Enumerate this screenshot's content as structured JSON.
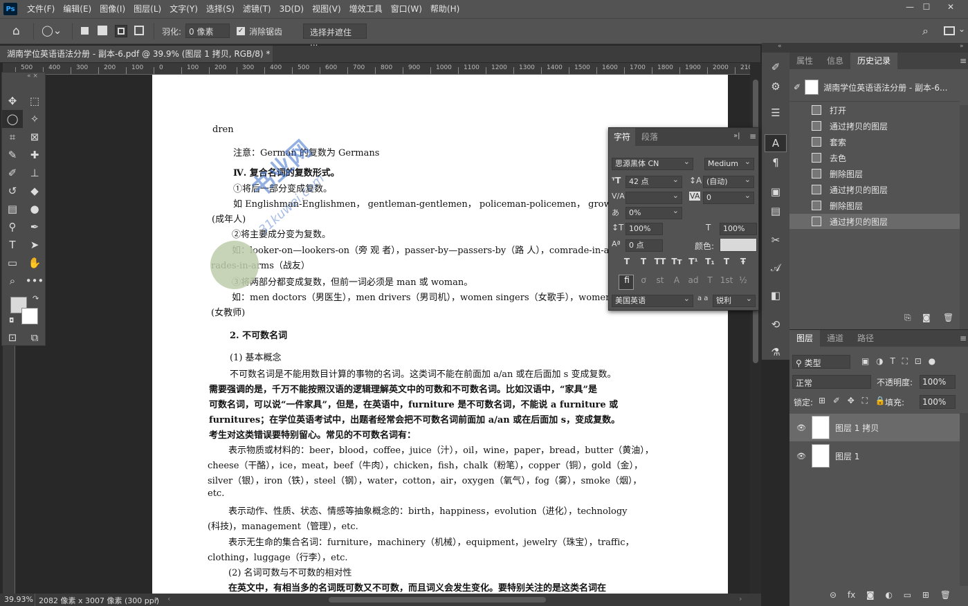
{
  "menu": [
    "文件(F)",
    "编辑(E)",
    "图像(I)",
    "图层(L)",
    "文字(Y)",
    "选择(S)",
    "滤镜(T)",
    "3D(D)",
    "视图(V)",
    "增效工具",
    "窗口(W)",
    "帮助(H)"
  ],
  "app_logo": "Ps",
  "options": {
    "feather_label": "羽化:",
    "feather_value": "0 像素",
    "antialias_label": "消除锯齿",
    "select_mask_label": "选择并遮住 ..."
  },
  "doc_tab": {
    "title": "湖南学位英语语法分册 - 副本-6.pdf @ 39.9% (图层 1 拷贝, RGB/8) *",
    "close": "×"
  },
  "ruler_h": [
    "500",
    "400",
    "300",
    "200",
    "100",
    "0",
    "100",
    "200",
    "300",
    "400",
    "500",
    "600",
    "700",
    "800",
    "900",
    "1000",
    "1100",
    "1200",
    "1300",
    "1400",
    "1500",
    "1600",
    "1700",
    "1800",
    "1900",
    "2000",
    "2100"
  ],
  "status": {
    "zoom": "39.93%",
    "info": "2082 像素 x 3007 像素 (300 ppi)"
  },
  "history_panel": {
    "tabs": [
      "属性",
      "信息",
      "历史记录"
    ],
    "snapshot": "湖南学位英语语法分册 - 副本-6...",
    "items": [
      "打开",
      "通过拷贝的图层",
      "套索",
      "去色",
      "删除图层",
      "通过拷贝的图层",
      "删除图层",
      "通过拷贝的图层"
    ]
  },
  "layers_panel": {
    "tabs": [
      "图层",
      "通道",
      "路径"
    ],
    "filter_label": "类型",
    "blend_mode": "正常",
    "opacity_label": "不透明度:",
    "opacity": "100%",
    "lock_label": "锁定:",
    "fill_label": "填充:",
    "fill": "100%",
    "layers": [
      {
        "name": "图层 1 拷贝",
        "selected": true
      },
      {
        "name": "图层 1",
        "selected": false
      }
    ]
  },
  "char_panel": {
    "tabs": [
      "字符",
      "段落"
    ],
    "font_family": "思源黑体 CN",
    "font_style": "Medium",
    "size": "42 点",
    "leading": "(自动)",
    "kerning": "",
    "tracking": "0",
    "scale_tsume": "0%",
    "vscale": "100%",
    "hscale": "100%",
    "baseline": "0 点",
    "color_label": "颜色:",
    "language": "美国英语",
    "antialias": "锐利",
    "aa_label": "a a",
    "style_buttons": [
      "T",
      "T",
      "TT",
      "Tт",
      "T¹",
      "T₁",
      "T",
      "Ŧ"
    ],
    "ot_buttons": [
      "fi",
      "ơ",
      "st",
      "A",
      "ad",
      "T",
      "1st",
      "½"
    ]
  },
  "watermark": {
    "line1": "书业网",
    "line2": "31kuwei.com"
  },
  "document_lines": [
    "dren",
    "注意：German 的复数为 Germans",
    "Ⅳ. 复合名词的复数形式。",
    "①将后一部分变成复数。",
    "如   Englishman-Englishmen， gentleman-gentlemen， policeman-policemen， grown-up",
    "(成年人)",
    "②将主要成分变为复数。",
    "如：looker-on—lookers-on（旁 观 者），passer-by—passers-by（路 人），comrade-in-arms—com-",
    "rades-in-arms（战友）",
    "③将两部分都变成复数，但前一词必须是 man 或 woman。",
    "如：men doctors（男医生），men drivers（男司机），women singers（女歌手），women teachers",
    "(女教师)",
    "2. 不可数名词",
    "(1) 基本概念",
    "不可数名词是不能用数目计算的事物的名词。这类词不能在前面加 a/an 或在后面加 s 变成复数。",
    "需要强调的是，千万不能按照汉语的逻辑理解英文中的可数和不可数名词。比如汉语中，“家具”是",
    "可数名词，可以说“一件家具”，但是，在英语中，furniture 是不可数名词，不能说 a furniture 或",
    "furnitures；在学位英语考试中，出题者经常会把不可数名词前面加 a/an 或在后面加 s，变成复数。",
    "考生对这类错误要特别留心。常见的不可数名词有：",
    "表示物质或材料的：beer，blood，coffee，juice（汁），oil，wine，paper，bread，butter（黄油），",
    "cheese（干酪），ice，meat，beef（牛肉），chicken，fish，chalk（粉笔），copper（铜），gold（金），",
    "silver（银），iron（铁），steel（钢），water，cotton，air，oxygen（氧气），fog（雾），smoke（烟），",
    "etc.",
    "表示动作、性质、状态、情感等抽象概念的：birth，happiness，evolution（进化），technology",
    "(科技)，management（管理），etc.",
    "表示无生命的集合名词：furniture，machinery（机械），equipment，jewelry（珠宝），traffic，",
    "clothing，luggage（行李），etc.",
    "(2) 名词可数与不可数的相对性",
    "在英文中，有相当多的名词既可数又不可数，而且词义会发生变化。要特别关注的是这类名词在"
  ]
}
